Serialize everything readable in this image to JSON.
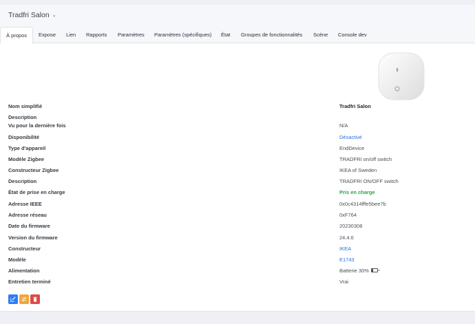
{
  "device": {
    "title": "Tradfri Salon"
  },
  "tabs": [
    {
      "label": "À propos",
      "active": true
    },
    {
      "label": "Expose"
    },
    {
      "label": "Lien"
    },
    {
      "label": "Rapports"
    },
    {
      "label": "Paramètres"
    },
    {
      "label": "Paramètres (spécifiques)"
    },
    {
      "label": "État"
    },
    {
      "label": "Groupes de fonctionnalités"
    },
    {
      "label": "Scène"
    },
    {
      "label": "Console dev"
    }
  ],
  "about": {
    "rows": [
      {
        "label": "Nom simplifié",
        "value": "Tradfri Salon",
        "style": "bold"
      },
      {
        "label": "Description",
        "value": ""
      },
      {
        "label": "Vu pour la dernière fois",
        "value": "N/A"
      },
      {
        "label": "Disponibilité",
        "value": "Désactivé",
        "style": "link"
      },
      {
        "label": "Type d'appareil",
        "value": "EndDevice"
      },
      {
        "label": "Modèle Zigbee",
        "value": "TRADFRI on/off switch"
      },
      {
        "label": "Constructeur Zigbee",
        "value": "IKEA of Sweden"
      },
      {
        "label": "Description",
        "value": "TRADFRI ON/OFF switch"
      },
      {
        "label": "État de prise en charge",
        "value": "Pris en charge",
        "style": "success"
      },
      {
        "label": "Adresse IEEE",
        "value": "0x0c4314fffe5bee7b"
      },
      {
        "label": "Adresse réseau",
        "value": "0xF764"
      },
      {
        "label": "Date du firmware",
        "value": "20230308"
      },
      {
        "label": "Version du firmware",
        "value": "24.4.6"
      },
      {
        "label": "Constructeur",
        "value": "IKEA",
        "style": "link"
      },
      {
        "label": "Modèle",
        "value": "E1743",
        "style": "link"
      },
      {
        "label": "Alimentation",
        "value": "Batterie 30%",
        "battery_level": 0.3
      },
      {
        "label": "Entretien terminé",
        "value": "Vrai"
      }
    ]
  },
  "actions": {
    "edit_icon": "pencil-square-icon",
    "swap_icon": "swap-arrows-icon",
    "delete_icon": "trash-icon",
    "colors": {
      "edit": "#2f7cf6",
      "swap": "#f0a83a",
      "delete": "#e04848"
    }
  }
}
